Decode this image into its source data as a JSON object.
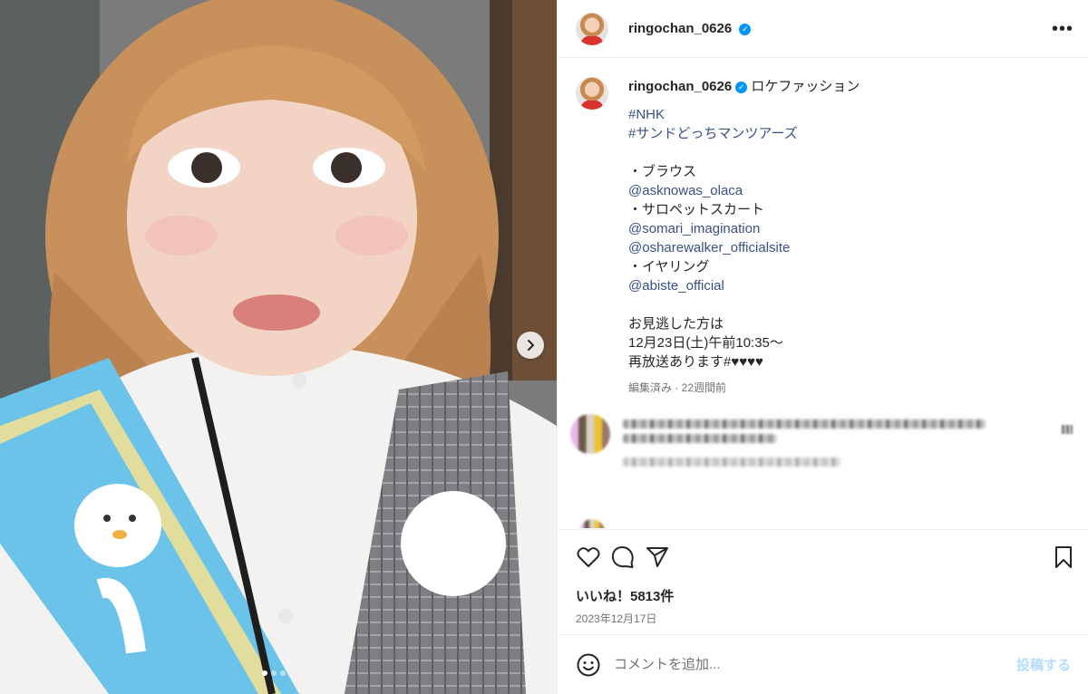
{
  "post": {
    "username": "ringochan_0626",
    "verified_icon": "verified-badge-icon",
    "more_icon": "more-dots-icon",
    "more_label": "•••"
  },
  "caption": {
    "username": "ringochan_0626",
    "first_text": "ロケファッション",
    "lines": [
      {
        "text": "#NHK",
        "kind": "tag"
      },
      {
        "text": "#サンドどっちマンツアーズ",
        "kind": "tag"
      },
      {
        "text": "",
        "kind": "blank"
      },
      {
        "text": "・ブラウス",
        "kind": "text"
      },
      {
        "text": "@asknowas_olaca",
        "kind": "tag"
      },
      {
        "text": "・サロペットスカート",
        "kind": "text"
      },
      {
        "text": "@somari_imagination",
        "kind": "tag"
      },
      {
        "text": "@osharewalker_officialsite",
        "kind": "tag"
      },
      {
        "text": "・イヤリング",
        "kind": "text"
      },
      {
        "text": "@abiste_official",
        "kind": "tag"
      },
      {
        "text": "",
        "kind": "blank"
      },
      {
        "text": "お見逃した方は",
        "kind": "text"
      },
      {
        "text": "12月23日(土)午前10:35〜",
        "kind": "text"
      },
      {
        "text": "再放送あります#♥♥♥♥",
        "kind": "text"
      }
    ],
    "meta": "編集済み · 22週間前"
  },
  "actions": {
    "like_icon": "heart-icon",
    "comment_icon": "comment-bubble-icon",
    "share_icon": "send-paper-plane-icon",
    "save_icon": "bookmark-icon"
  },
  "likes_text": "いいね！5813件",
  "date_text": "2023年12月17日",
  "comment_box": {
    "emoji_icon": "smiley-icon",
    "placeholder": "コメントを追加...",
    "post_label": "投稿する"
  },
  "carousel": {
    "next_icon": "chevron-right-icon",
    "slide_count": 3,
    "active_slide": 1
  },
  "colors": {
    "link": "#385185",
    "verified": "#0095f6",
    "post_button_disabled": "#b3dbff",
    "meta_text": "#737373"
  }
}
